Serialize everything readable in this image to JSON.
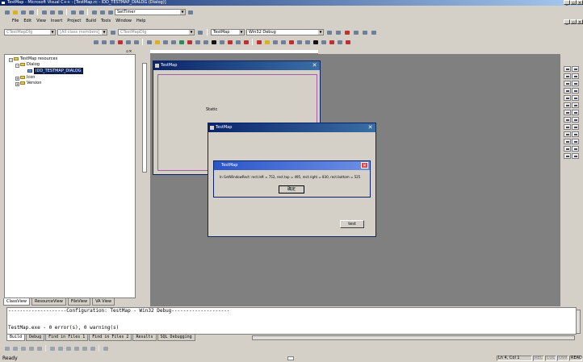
{
  "window": {
    "title": "TestMap - Microsoft Visual C++ - [TestMap.rc - IDD_TESTMAP_DIALOG (Dialog)]",
    "min": "_",
    "max": "▫",
    "close": "×"
  },
  "toolbar1": {
    "find_combo": "SetTimer"
  },
  "menu": [
    "File",
    "Edit",
    "View",
    "Insert",
    "Project",
    "Build",
    "Tools",
    "Window",
    "Help"
  ],
  "wizardbar": {
    "class": "CTestMapDlg",
    "filter": "[All class members]",
    "member": "CTestMapDlg"
  },
  "buildbar": {
    "project": "TestMap",
    "config": "Win32 Debug"
  },
  "tree": {
    "root": "TestMap resources",
    "dialog": "Dialog",
    "dialog_item": "IDD_TESTMAP_DIALOG",
    "icon": "Icon",
    "version": "Version"
  },
  "panel_tabs": [
    "ClassView",
    "ResourceView",
    "FileView",
    "VA View"
  ],
  "design_dialog": {
    "title": "TestMap",
    "static_text": "Static"
  },
  "runtime_dialog": {
    "title": "TestMap",
    "button": "test"
  },
  "message_box": {
    "title": "TestMap",
    "text": "In GetWindowRect: rect.left = 752, rect.top = 495, rect.right = 830, rect.bottom = 525",
    "ok": "确定"
  },
  "output": {
    "line1": "--------------------Configuration: TestMap - Win32 Debug--------------------",
    "line2": "TestMap.exe - 0 error(s), 0 warning(s)"
  },
  "output_tabs": [
    "Build",
    "Debug",
    "Find in Files 1",
    "Find in Files 2",
    "Results",
    "SQL Debugging"
  ],
  "status": {
    "ready": "Ready",
    "position": "Ln 4, Col 1",
    "rec": "REC",
    "col": "COL",
    "ovr": "OVR",
    "read": "READ"
  }
}
